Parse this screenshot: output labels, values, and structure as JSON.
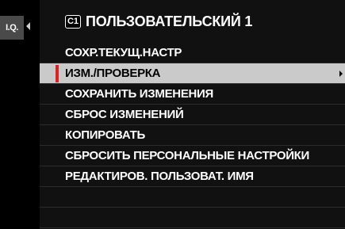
{
  "sidebar": {
    "tab_label": "I.Q."
  },
  "header": {
    "badge": "C1",
    "title": "ПОЛЬЗОВАТЕЛЬСКИЙ 1"
  },
  "menu": {
    "items": [
      {
        "label": "СОХР.ТЕКУЩ.НАСТР"
      },
      {
        "label": "ИЗМ./ПРОВЕРКА",
        "selected": true
      },
      {
        "label": "СОХРАНИТЬ ИЗМЕНЕНИЯ"
      },
      {
        "label": "СБРОС ИЗМЕНЕНИЙ"
      },
      {
        "label": "КОПИРОВАТЬ"
      },
      {
        "label": "СБРОСИТЬ ПЕРСОНАЛЬНЫЕ НАСТРОЙКИ"
      },
      {
        "label": "РЕДАКТИРОВ. ПОЛЬЗОВАТ. ИМЯ"
      }
    ]
  },
  "colors": {
    "selection_marker": "#e02020",
    "selection_bg": "#cacaca",
    "panel_bg": "#111111"
  }
}
